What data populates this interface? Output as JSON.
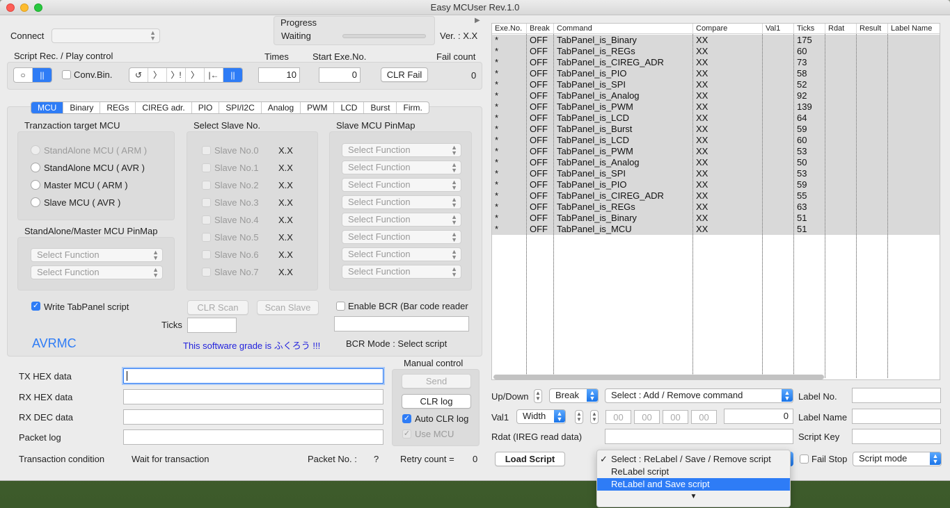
{
  "window": {
    "title": "Easy MCUser Rev.1.0"
  },
  "connect": {
    "label": "Connect",
    "value": ""
  },
  "progress": {
    "label": "Progress",
    "status": "Waiting",
    "value": 0,
    "version": "Ver. : X.X"
  },
  "script_control": {
    "label": "Script Rec. / Play control",
    "rec_buttons": [
      "○",
      "||"
    ],
    "conv_bin": "Conv.Bin.",
    "play_buttons": [
      "↺",
      "〉",
      "〉!",
      "〉",
      "|←",
      "||"
    ],
    "times_label": "Times",
    "times_value": "10",
    "start_label": "Start Exe.No.",
    "start_value": "0",
    "clr_fail": "CLR Fail",
    "fail_label": "Fail count",
    "fail_value": "0"
  },
  "tabs": [
    "MCU",
    "Binary",
    "REGs",
    "CIREG adr.",
    "PIO",
    "SPI/I2C",
    "Analog",
    "PWM",
    "LCD",
    "Burst",
    "Firm."
  ],
  "mcu_panel": {
    "target_label": "Tranzaction target MCU",
    "targets": [
      "StandAlone MCU ( ARM )",
      "StandAlone MCU ( AVR )",
      "Master MCU ( ARM )",
      "Slave MCU ( AVR )"
    ],
    "slave_label": "Select Slave No.",
    "slaves": [
      "Slave No.0",
      "Slave No.1",
      "Slave No.2",
      "Slave No.3",
      "Slave No.4",
      "Slave No.5",
      "Slave No.6",
      "Slave No.7"
    ],
    "slave_value": "X.X",
    "slave_pinmap_label": "Slave MCU PinMap",
    "select_function": "Select Function",
    "master_pinmap_label": "StandAlone/Master MCU PinMap",
    "write_tabpanel": "Write TabPanel script",
    "clr_scan": "CLR Scan",
    "scan_slave": "Scan Slave",
    "enable_bcr": "Enable BCR (Bar code reader",
    "ticks_label": "Ticks",
    "avrmc": "AVRMC",
    "grade": "This software grade is ふくろう !!!",
    "bcr_mode": "BCR Mode : Select script"
  },
  "hex": {
    "tx": "TX HEX data",
    "rx": "RX HEX data",
    "rxdec": "RX DEC data",
    "packet": "Packet log",
    "transaction_label": "Transaction condition",
    "transaction_value": "Wait for transaction",
    "packet_no_label": "Packet No. :",
    "packet_no_value": "?",
    "retry_label": "Retry count  =",
    "retry_value": "0"
  },
  "manual": {
    "label": "Manual control",
    "send": "Send",
    "clr_log": "CLR log",
    "auto_clr": "Auto CLR log",
    "use_mcu": "Use MCU"
  },
  "table": {
    "headers": [
      "Exe.No.",
      "Break",
      "Command",
      "Compare",
      "Val1",
      "Ticks",
      "Rdat",
      "Result",
      "Label Name"
    ],
    "rows": [
      [
        "*",
        "OFF",
        "TabPanel_is_Binary",
        "XX",
        "",
        "175"
      ],
      [
        "*",
        "OFF",
        "TabPanel_is_REGs",
        "XX",
        "",
        "60"
      ],
      [
        "*",
        "OFF",
        "TabPanel_is_CIREG_ADR",
        "XX",
        "",
        "73"
      ],
      [
        "*",
        "OFF",
        "TabPanel_is_PIO",
        "XX",
        "",
        "58"
      ],
      [
        "*",
        "OFF",
        "TabPanel_is_SPI",
        "XX",
        "",
        "52"
      ],
      [
        "*",
        "OFF",
        "TabPanel_is_Analog",
        "XX",
        "",
        "92"
      ],
      [
        "*",
        "OFF",
        "TabPanel_is_PWM",
        "XX",
        "",
        "139"
      ],
      [
        "*",
        "OFF",
        "TabPanel_is_LCD",
        "XX",
        "",
        "64"
      ],
      [
        "*",
        "OFF",
        "TabPanel_is_Burst",
        "XX",
        "",
        "59"
      ],
      [
        "*",
        "OFF",
        "TabPanel_is_LCD",
        "XX",
        "",
        "60"
      ],
      [
        "*",
        "OFF",
        "TabPanel_is_PWM",
        "XX",
        "",
        "53"
      ],
      [
        "*",
        "OFF",
        "TabPanel_is_Analog",
        "XX",
        "",
        "50"
      ],
      [
        "*",
        "OFF",
        "TabPanel_is_SPI",
        "XX",
        "",
        "53"
      ],
      [
        "*",
        "OFF",
        "TabPanel_is_PIO",
        "XX",
        "",
        "59"
      ],
      [
        "*",
        "OFF",
        "TabPanel_is_CIREG_ADR",
        "XX",
        "",
        "55"
      ],
      [
        "*",
        "OFF",
        "TabPanel_is_REGs",
        "XX",
        "",
        "63"
      ],
      [
        "*",
        "OFF",
        "TabPanel_is_Binary",
        "XX",
        "",
        "51"
      ],
      [
        "*",
        "OFF",
        "TabPanel_is_MCU",
        "XX",
        "",
        "51"
      ]
    ]
  },
  "editor": {
    "updown": "Up/Down",
    "break_value": "Break",
    "command_select": "Select : Add / Remove command",
    "label_no": "Label No.",
    "val1": "Val1",
    "width": "Width",
    "hex_boxes": [
      "00",
      "00",
      "00",
      "00"
    ],
    "val_value": "0",
    "label_name": "Label Name",
    "rdat": "Rdat (IREG read data)",
    "script_key": "Script Key",
    "load_script": "Load Script",
    "fail_stop": "Fail Stop",
    "script_mode": "Script mode"
  },
  "relabel_menu": {
    "options": [
      "Select : ReLabel / Save / Remove script",
      "ReLabel script",
      "ReLabel and Save script"
    ],
    "checked": "✓",
    "more": "▼"
  }
}
